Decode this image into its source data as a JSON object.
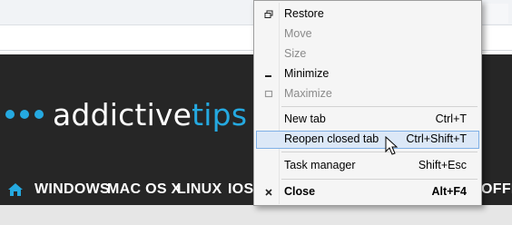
{
  "site": {
    "logo_main": "addictive",
    "logo_accent": "tips",
    "nav": [
      "WINDOWS",
      "MAC OS X",
      "LINUX",
      "IOS",
      "OFFIC"
    ]
  },
  "menu": {
    "items": [
      {
        "label": "Restore",
        "shortcut": "",
        "icon": "restore-icon",
        "disabled": false
      },
      {
        "label": "Move",
        "shortcut": "",
        "icon": "",
        "disabled": true
      },
      {
        "label": "Size",
        "shortcut": "",
        "icon": "",
        "disabled": true
      },
      {
        "label": "Minimize",
        "shortcut": "",
        "icon": "minimize-icon",
        "disabled": false
      },
      {
        "label": "Maximize",
        "shortcut": "",
        "icon": "maximize-icon",
        "disabled": true
      },
      {
        "label": "New tab",
        "shortcut": "Ctrl+T",
        "icon": "",
        "disabled": false
      },
      {
        "label": "Reopen closed tab",
        "shortcut": "Ctrl+Shift+T",
        "icon": "",
        "disabled": false,
        "highlighted": true
      },
      {
        "label": "Task manager",
        "shortcut": "Shift+Esc",
        "icon": "",
        "disabled": false
      },
      {
        "label": "Close",
        "shortcut": "Alt+F4",
        "icon": "close-icon",
        "disabled": false,
        "bold": true
      }
    ]
  },
  "colors": {
    "brand_blue": "#25a9e0",
    "site_background": "#262626",
    "menu_background": "#f5f5f5",
    "menu_highlight": "#dce8f7"
  }
}
